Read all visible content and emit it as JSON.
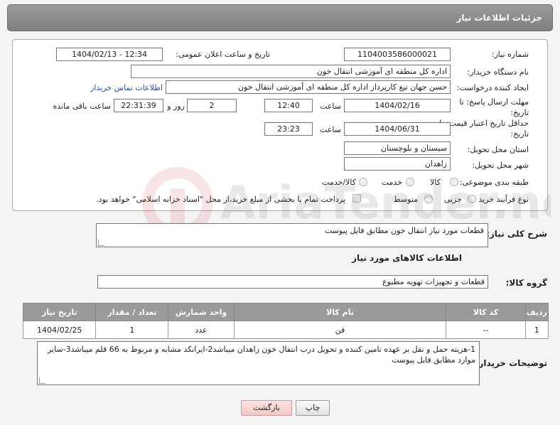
{
  "header": {
    "title": "جزئیات اطلاعات نیاز"
  },
  "form": {
    "need_number_label": "شماره نیاز:",
    "need_number": "1104003586000021",
    "announce_label": "تاریخ و ساعت اعلان عمومی:",
    "announce_value": "1404/02/13 - 12:34",
    "buyer_label": "نام دستگاه خریدار:",
    "buyer_value": "اداره کل منطقه ای آموزشی انتقال خون",
    "creator_label": "ایجاد کننده درخواست:",
    "creator_value": "حسن جهان تیغ کارپرداز اداره کل منطقه ای آموزشی انتقال خون",
    "contact_link": "اطلاعات تماس خریدار",
    "deadline_label": "مهلت ارسال پاسخ: تا تاریخ:",
    "deadline_date": "1404/02/16",
    "time_label": "ساعت",
    "deadline_time": "12:40",
    "days_value": "2",
    "days_label": "روز و",
    "remaining_value": "22:31:39",
    "remaining_label": "ساعت باقی مانده",
    "price_validity_label": "حداقل تاریخ اعتبار قیمت: تا تاریخ:",
    "price_date": "1404/06/31",
    "price_time_label": "ساعت",
    "price_time": "23:23",
    "province_label": "استان محل تحویل:",
    "province_value": "سیستان و بلوچستان",
    "city_label": "شهر محل تحویل:",
    "city_value": "زاهدان",
    "category_label": "طبقه بندی موضوعی:",
    "category_options": [
      "کالا",
      "خدمت",
      "کالا/خدمت"
    ],
    "process_label": "نوع فرآیند خرید :",
    "process_options": [
      "جزیی",
      "متوسط"
    ],
    "payment_note": "پرداخت تمام یا بخشی از مبلغ خرید،از محل \"اسناد خزانه اسلامی\" خواهد بود."
  },
  "summary": {
    "label": "شرح کلی نیاز:",
    "value": "قطعات مورد نیاز انتقال خون مطابق فایل پیوست"
  },
  "goods": {
    "section_title": "اطلاعات کالاهای مورد نیاز",
    "group_label": "گروه کالا:",
    "group_value": "قطعات و تجهیزات تهویه مطبوع",
    "columns": [
      "ردیف",
      "کد کالا",
      "نام کالا",
      "واحد شمارش",
      "تعداد / مقدار",
      "تاریخ نیاز"
    ],
    "rows": [
      [
        "1",
        "--",
        "فن",
        "عدد",
        "1",
        "1404/02/25"
      ]
    ]
  },
  "buyer_notes": {
    "label": "توضیحات خریدار:",
    "value": "1-هزینه حمل و نقل بر عهده تامین کننده و تحویل درب انتقال خون زاهدان میباشد2-ایرانکد مشابه و مربوط به 66 قلم میباشد3-سایر موارد مطابق فایل پیوست"
  },
  "buttons": {
    "print": "چاپ",
    "back": "بازگشت"
  },
  "watermark": {
    "text": "AriaTender.neT"
  }
}
